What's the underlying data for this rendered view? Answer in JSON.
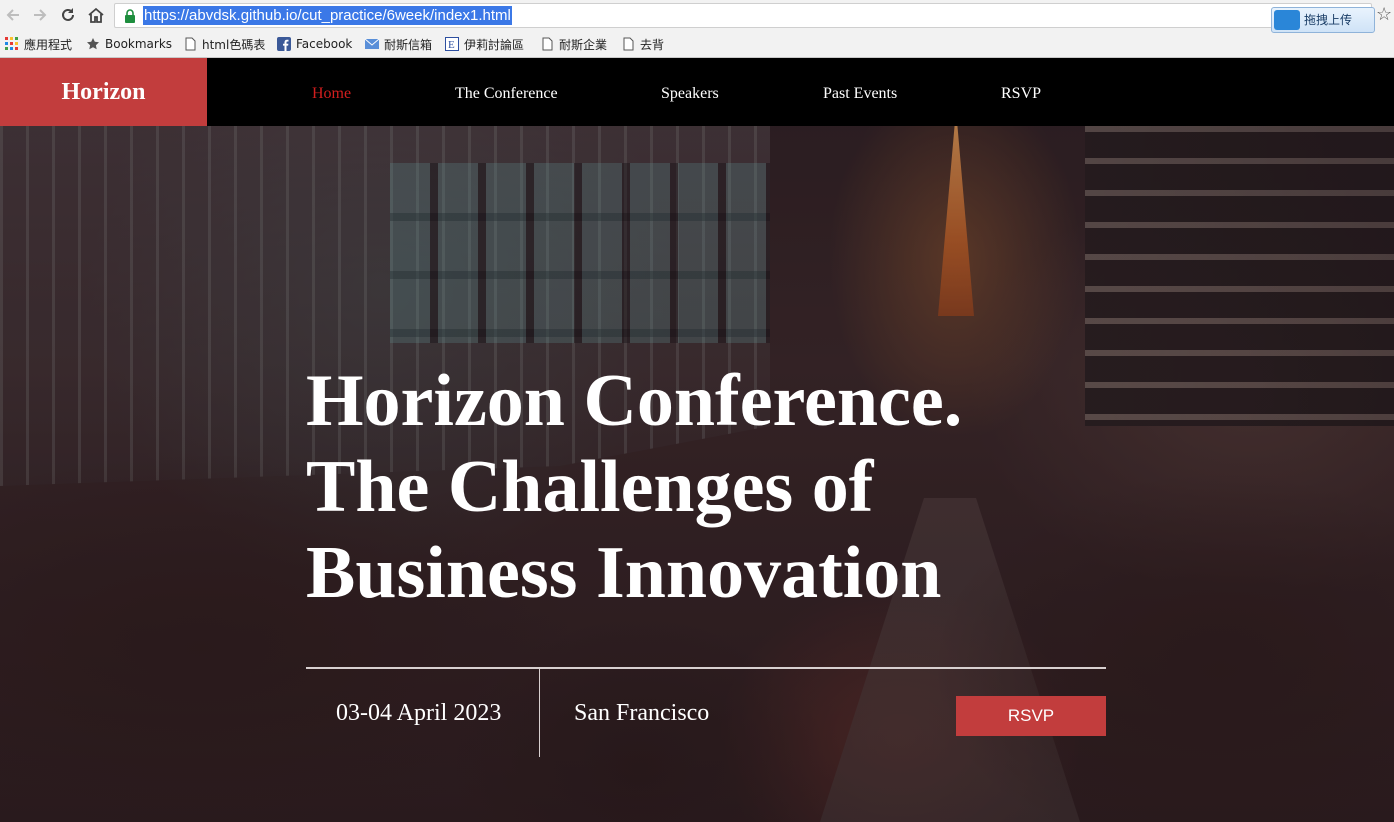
{
  "browser": {
    "url": "https://abvdsk.github.io/cut_practice/6week/index1.html",
    "extension_label": "拖拽上传",
    "bookmarks": [
      {
        "label": "應用程式",
        "icon": "apps-grid-icon"
      },
      {
        "label": "Bookmarks",
        "icon": "star-folder-icon"
      },
      {
        "label": "html色碼表",
        "icon": "page-icon"
      },
      {
        "label": "Facebook",
        "icon": "facebook-icon"
      },
      {
        "label": "耐斯信箱",
        "icon": "mail-icon"
      },
      {
        "label": "伊莉討論區",
        "icon": "forum-e-icon"
      },
      {
        "label": "耐斯企業",
        "icon": "page-icon"
      },
      {
        "label": "去背",
        "icon": "page-icon"
      }
    ]
  },
  "site": {
    "logo": "Horizon",
    "nav": [
      {
        "label": "Home",
        "active": true
      },
      {
        "label": "The Conference",
        "active": false
      },
      {
        "label": "Speakers",
        "active": false
      },
      {
        "label": "Past Events",
        "active": false
      },
      {
        "label": "RSVP",
        "active": false
      }
    ]
  },
  "hero": {
    "headline_lines": [
      "Horizon Conference.",
      "The Challenges of",
      "Business Innovation"
    ],
    "date": "03-04 April 2023",
    "location": "San Francisco",
    "cta": "RSVP"
  },
  "colors": {
    "accent": "#c23d3d",
    "nav_active": "#d21e1e",
    "header_bg": "#000000",
    "url_highlight": "#3b78e7"
  }
}
